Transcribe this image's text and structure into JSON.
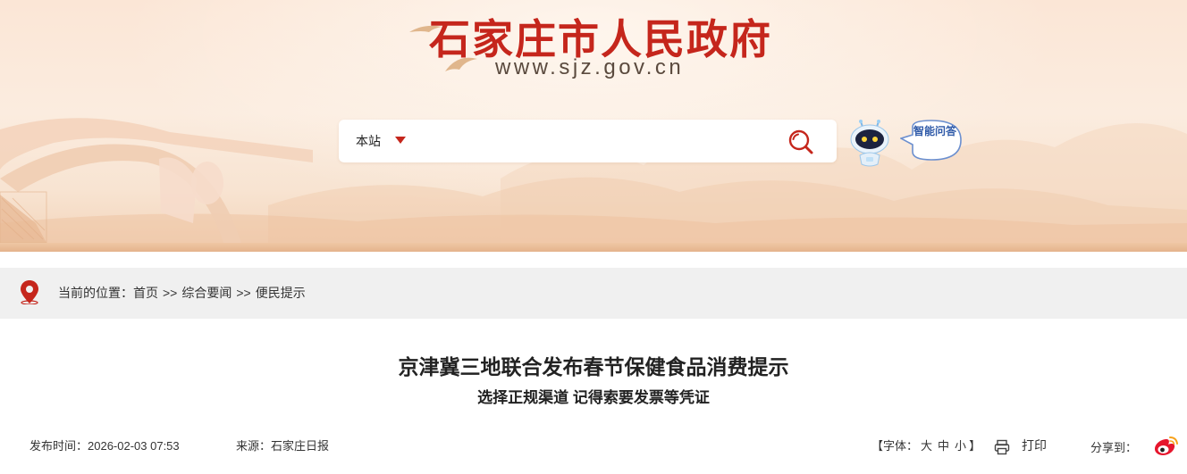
{
  "header": {
    "site_title": "石家庄市人民政府",
    "site_url": "www.sjz.gov.cn"
  },
  "search": {
    "scope_label": "本站",
    "placeholder": "",
    "value": "",
    "icon": "search-icon"
  },
  "assistant": {
    "robot_icon": "robot-icon",
    "label": "智能问答"
  },
  "breadcrumb": {
    "prefix": "当前的位置：",
    "items": [
      "首页",
      "综合要闻",
      "便民提示"
    ],
    "separator": ">>"
  },
  "article": {
    "title": "京津冀三地联合发布春节保健食品消费提示",
    "subtitle": "选择正规渠道 记得索要发票等凭证",
    "publish_time": "发布时间：2026-02-03 07:53",
    "source": "来源：石家庄日报",
    "font_size": {
      "prefix": "【字体：",
      "sizes": [
        "大",
        "中",
        "小"
      ],
      "suffix": "】"
    },
    "print_label": "打印",
    "share_label": "分享到："
  },
  "colors": {
    "brand_red": "#c5261c",
    "banner_bg": "#fbe6d6",
    "breadcrumb_bg": "#f0f0f0",
    "qa_blue": "#2f5aa8"
  }
}
